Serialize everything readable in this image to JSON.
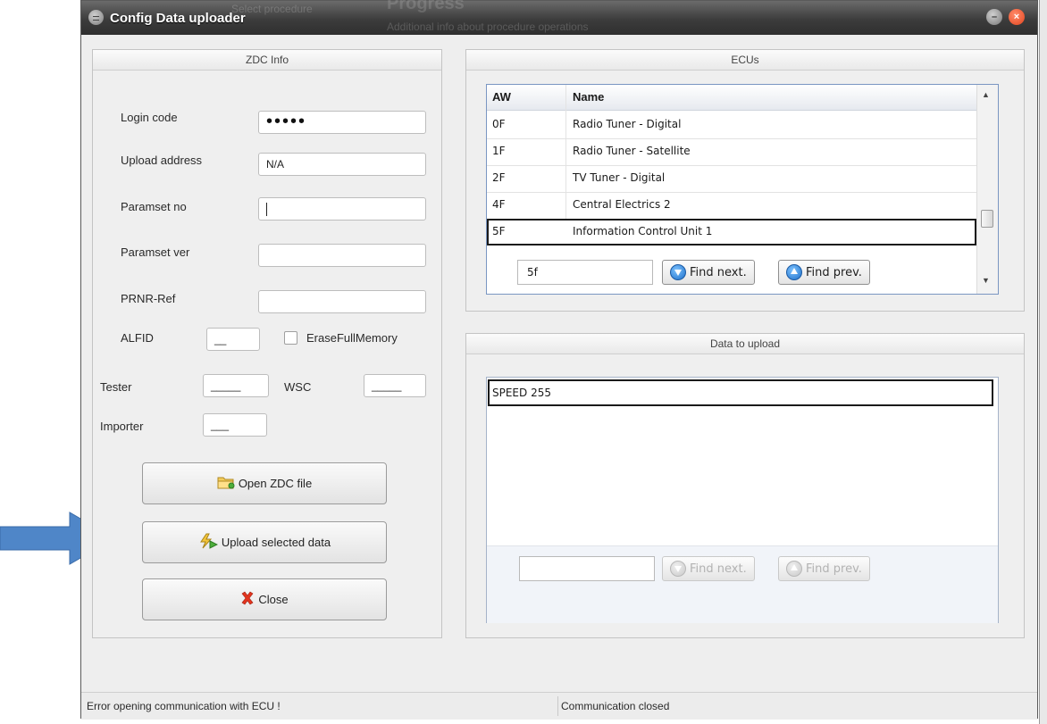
{
  "window": {
    "title": "Config Data uploader",
    "bg_text_1": "Select procedure",
    "bg_text_2": "Progress",
    "bg_text_3": "Additional info about procedure operations",
    "min_icon": "minimize-icon",
    "close_icon": "close-icon"
  },
  "zdc": {
    "header": "ZDC Info",
    "login_label": "Login code",
    "login_value": "•••••",
    "upload_addr_label": "Upload address",
    "upload_addr_value": "N/A",
    "paramset_no_label": "Paramset no",
    "paramset_ver_label": "Paramset ver",
    "prnr_label": "PRNR-Ref",
    "alfid_label": "ALFID",
    "alfid_value": "__",
    "erase_label": "EraseFullMemory",
    "tester_label": "Tester",
    "tester_value": "_____",
    "wsc_label": "WSC",
    "wsc_value": "_____",
    "importer_label": "Importer",
    "importer_value": "___",
    "open_btn": "Open ZDC file",
    "upload_btn": "Upload selected data",
    "close_btn": "Close"
  },
  "ecus": {
    "header": "ECUs",
    "columns": [
      "AW",
      "Name"
    ],
    "rows": [
      {
        "aw": "0F",
        "name": "Radio Tuner - Digital"
      },
      {
        "aw": "1F",
        "name": "Radio Tuner - Satellite"
      },
      {
        "aw": "2F",
        "name": "TV Tuner - Digital"
      },
      {
        "aw": "4F",
        "name": "Central Electrics 2"
      },
      {
        "aw": "5F",
        "name": "Information Control Unit 1"
      }
    ],
    "search_value": "5f",
    "find_next": "Find next.",
    "find_prev": "Find prev."
  },
  "upload": {
    "header": "Data to upload",
    "rows": [
      "SPEED 255"
    ],
    "search_value": "",
    "find_next": "Find next.",
    "find_prev": "Find prev."
  },
  "status": {
    "left": "Error opening communication with ECU !",
    "right": "Communication closed"
  },
  "colors": {
    "arrow": "#4f86c8",
    "title_bar": "#3c3c3c",
    "accent_blue": "#1d6fc9"
  }
}
